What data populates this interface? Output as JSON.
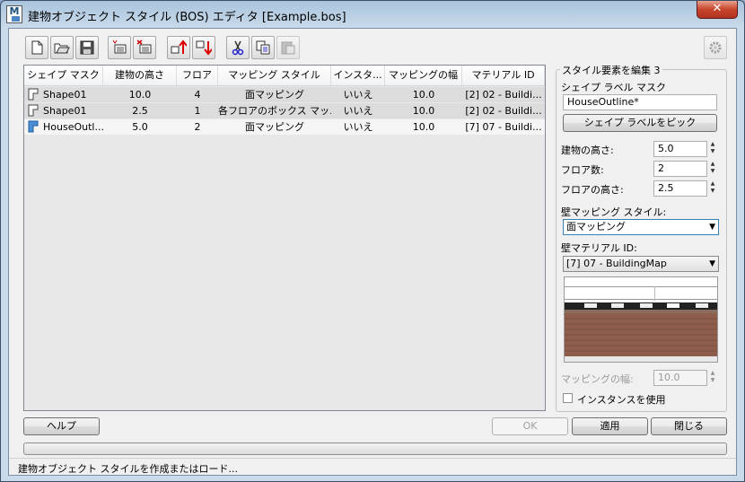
{
  "window": {
    "title": "建物オブジェクト スタイル (BOS) エディタ [Example.bos]",
    "app_icon_text": "M"
  },
  "toolbar": {
    "buttons": [
      "new-icon",
      "open-icon",
      "save-icon",
      "add-style-icon",
      "delete-style-icon",
      "move-up-icon",
      "move-down-icon",
      "cut-icon",
      "copy-icon",
      "paste-icon"
    ],
    "settings": "settings-icon"
  },
  "table": {
    "columns": [
      "シェイプ マスク",
      "建物の高さ",
      "フロア",
      "マッピング スタイル",
      "インスタ...",
      "マッピングの幅",
      "マテリアル ID"
    ],
    "rows": [
      [
        "Shape01",
        "10.0",
        "4",
        "面マッピング",
        "いいえ",
        "10.0",
        "[2] 02 - Buildi..."
      ],
      [
        "Shape01",
        "2.5",
        "1",
        "各フロアのボックス マッ...",
        "いいえ",
        "10.0",
        "[2] 02 - Buildi..."
      ],
      [
        "HouseOutl...",
        "5.0",
        "2",
        "面マッピング",
        "いいえ",
        "10.0",
        "[7] 07 - Buildi..."
      ]
    ]
  },
  "panel": {
    "group_title": "スタイル要素を編集 3",
    "shape_label": "シェイプ ラベル マスク",
    "shape_value": "HouseOutline*",
    "pick_button": "シェイプ ラベルをピック",
    "height_label": "建物の高さ:",
    "height_value": "5.0",
    "floors_label": "フロア数:",
    "floors_value": "2",
    "floor_height_label": "フロアの高さ:",
    "floor_height_value": "2.5",
    "wall_mapping_label": "壁マッピング スタイル:",
    "wall_mapping_value": "面マッピング",
    "wall_material_label": "壁マテリアル ID:",
    "wall_material_value": "[7] 07 - BuildingMap",
    "mapping_width_label": "マッピングの幅:",
    "mapping_width_value": "10.0",
    "instance_label": "インスタンスを使用"
  },
  "buttons": {
    "help": "ヘルプ",
    "ok": "OK",
    "apply": "適用",
    "close": "閉じる"
  },
  "status": "建物オブジェクト スタイルを作成またはロード..."
}
